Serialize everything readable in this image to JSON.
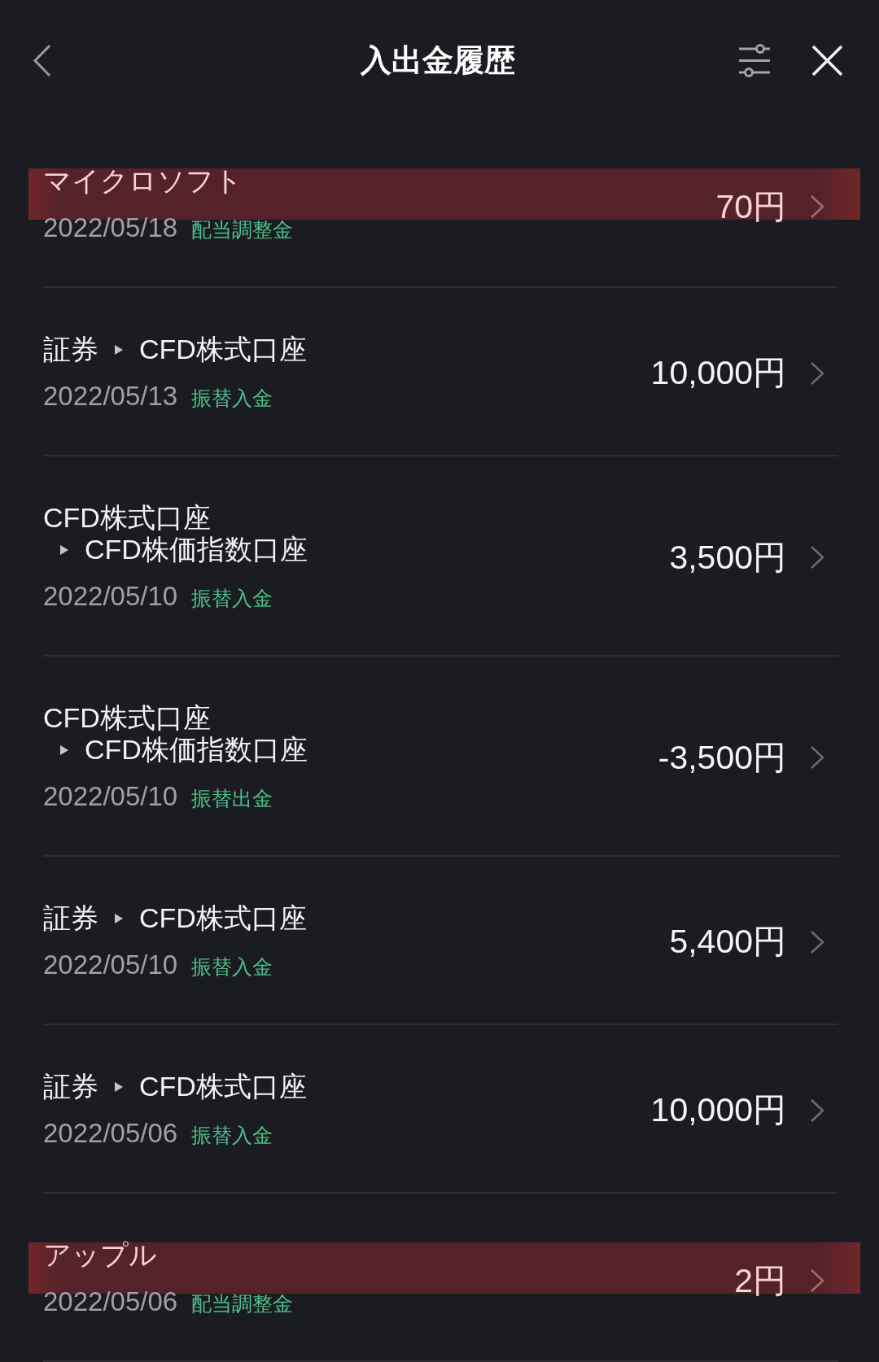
{
  "header": {
    "title": "入出金履歴"
  },
  "transactions": [
    {
      "kind": "single",
      "name": "マイクロソフト",
      "date": "2022/05/18",
      "type": "配当調整金",
      "amount": "70円",
      "highlighted": true
    },
    {
      "kind": "transfer_inline",
      "from": "証券",
      "to": "CFD株式口座",
      "date": "2022/05/13",
      "type": "振替入金",
      "amount": "10,000円",
      "highlighted": false
    },
    {
      "kind": "transfer_stacked",
      "from": "CFD株式口座",
      "to": "CFD株価指数口座",
      "date": "2022/05/10",
      "type": "振替入金",
      "amount": "3,500円",
      "highlighted": false
    },
    {
      "kind": "transfer_stacked",
      "from": "CFD株式口座",
      "to": "CFD株価指数口座",
      "date": "2022/05/10",
      "type": "振替出金",
      "amount": "-3,500円",
      "highlighted": false
    },
    {
      "kind": "transfer_inline",
      "from": "証券",
      "to": "CFD株式口座",
      "date": "2022/05/10",
      "type": "振替入金",
      "amount": "5,400円",
      "highlighted": false
    },
    {
      "kind": "transfer_inline",
      "from": "証券",
      "to": "CFD株式口座",
      "date": "2022/05/06",
      "type": "振替入金",
      "amount": "10,000円",
      "highlighted": false
    },
    {
      "kind": "single",
      "name": "アップル",
      "date": "2022/05/06",
      "type": "配当調整金",
      "amount": "2円",
      "highlighted": true
    }
  ]
}
